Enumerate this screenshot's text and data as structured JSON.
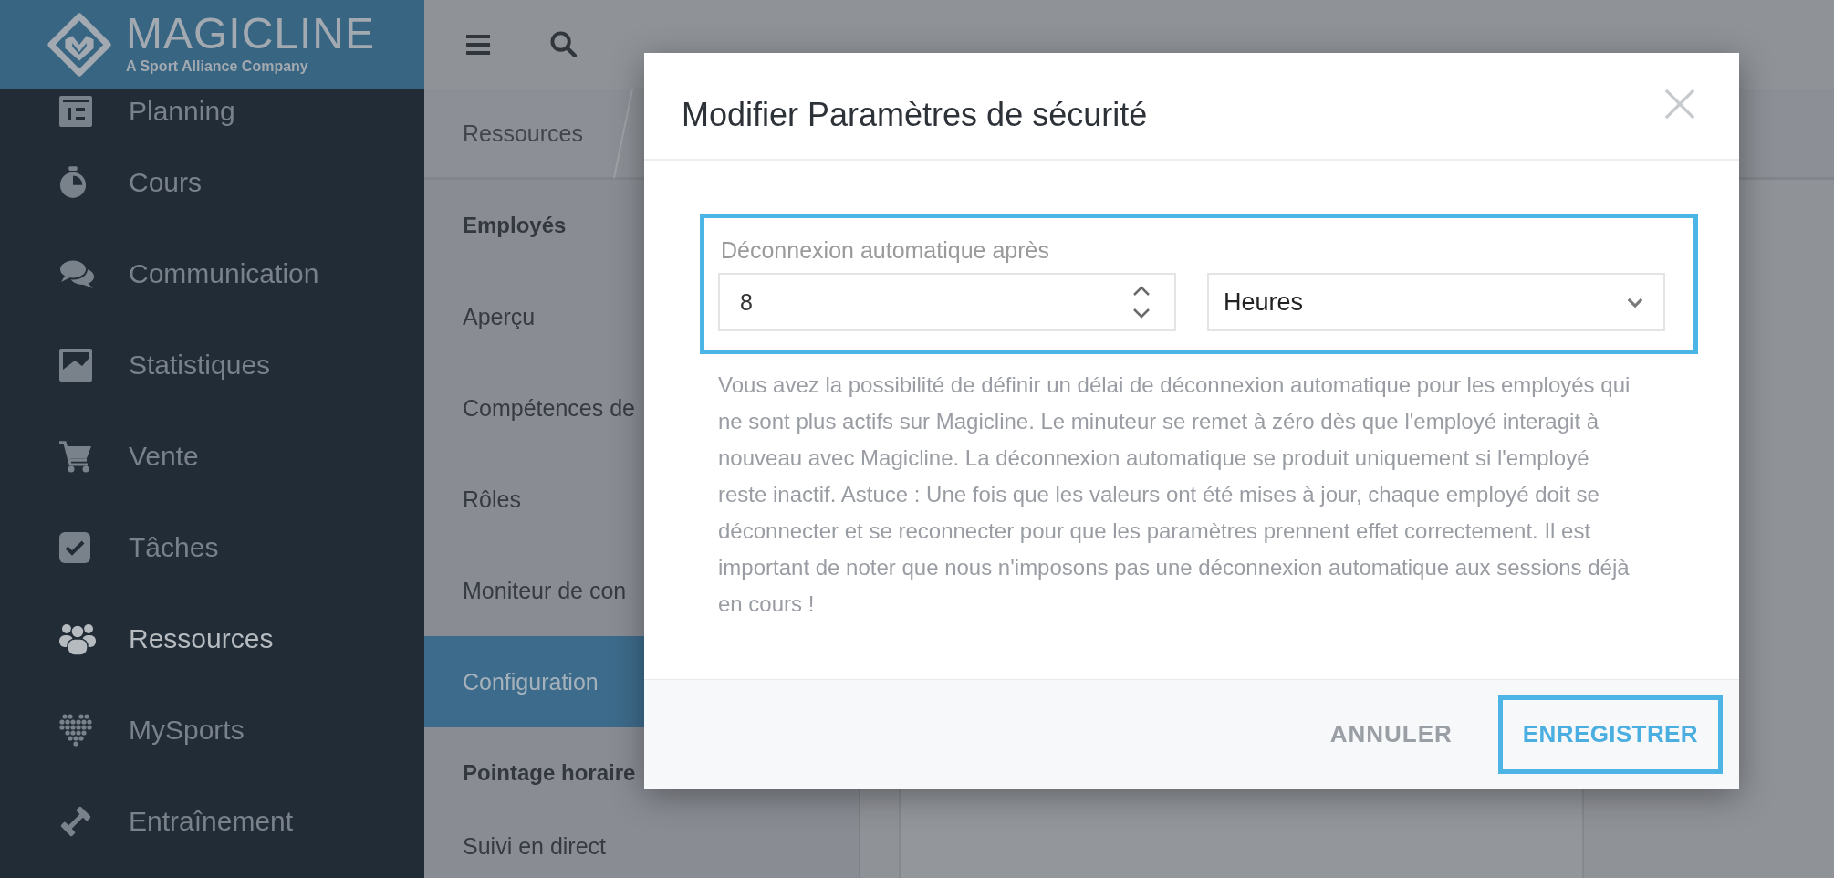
{
  "brand": {
    "name": "MAGICLINE",
    "tagline": "A Sport Alliance Company"
  },
  "sidebar": {
    "items": [
      {
        "label": "Planning",
        "selected": false
      },
      {
        "label": "Cours",
        "selected": false
      },
      {
        "label": "Communication",
        "selected": false
      },
      {
        "label": "Statistiques",
        "selected": false
      },
      {
        "label": "Vente",
        "selected": false
      },
      {
        "label": "Tâches",
        "selected": false
      },
      {
        "label": "Ressources",
        "selected": true
      },
      {
        "label": "MySports",
        "selected": false
      },
      {
        "label": "Entraînement",
        "selected": false
      }
    ]
  },
  "breadcrumb": [
    "Ressources"
  ],
  "subnav": {
    "sections": [
      {
        "heading": "Employés",
        "items": [
          {
            "label": "Aperçu",
            "selected": false
          },
          {
            "label": "Compétences de",
            "selected": false
          },
          {
            "label": "Rôles",
            "selected": false
          },
          {
            "label": "Moniteur de con",
            "selected": false
          },
          {
            "label": "Configuration",
            "selected": true
          }
        ]
      },
      {
        "heading": "Pointage horaire",
        "items": [
          {
            "label": "Suivi en direct",
            "selected": false
          }
        ]
      }
    ]
  },
  "dialog": {
    "title": "Modifier Paramètres de sécurité",
    "setting": {
      "highlighted": true,
      "label": "Déconnexion automatique après",
      "number_value": "8",
      "unit_value": "Heures"
    },
    "description": "Vous avez la possibilité de définir un délai de déconnexion automatique pour les employés qui ne sont plus actifs sur Magicline. Le minuteur se remet à zéro dès que l'employé interagit à nouveau avec Magicline. La déconnexion automatique se produit uniquement si l'employé reste inactif. Astuce : Une fois que les valeurs ont été mises à jour, chaque employé doit se déconnecter et se reconnecter pour que les paramètres prennent effet correctement. Il est important de noter que nous n'imposons pas une déconnexion automatique aux sessions déjà en cours !",
    "buttons": [
      {
        "label": "ANNULER",
        "kind": "secondary",
        "highlighted": false
      },
      {
        "label": "ENREGISTRER",
        "kind": "primary",
        "highlighted": true
      }
    ]
  }
}
